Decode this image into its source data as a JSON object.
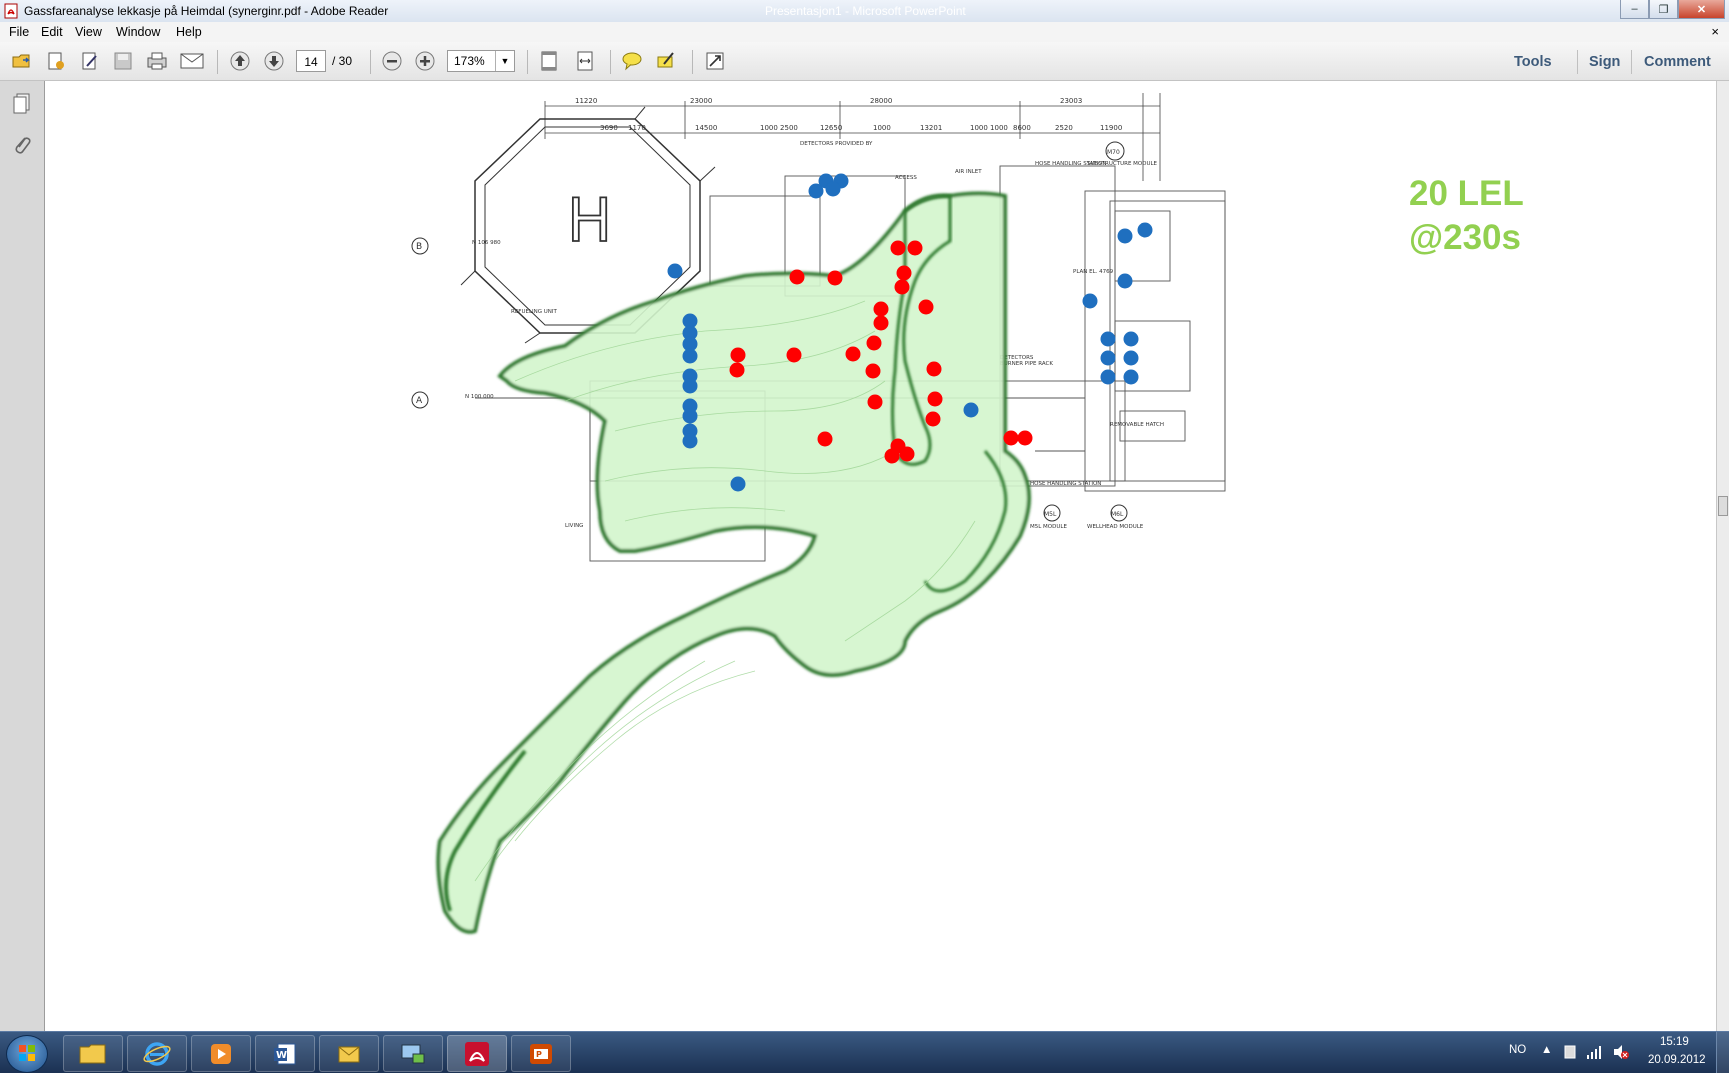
{
  "window": {
    "title": "Gassfareanalyse lekkasje på Heimdal (synerginr.pdf - Adobe Reader",
    "background_title": "Presentasjon1 - Microsoft PowerPoint",
    "minimize": "–",
    "maximize": "❐",
    "close": "✕"
  },
  "menu": {
    "items": [
      "File",
      "Edit",
      "View",
      "Window",
      "Help"
    ],
    "doc_close": "×"
  },
  "toolbar": {
    "page_current": "14",
    "page_total": "/ 30",
    "zoom": "173%",
    "right_links": [
      "Tools",
      "Sign",
      "Comment"
    ]
  },
  "document": {
    "overlay_line1": "20 LEL",
    "overlay_line2": "@230s",
    "colors": {
      "gas_fill": "#d3f5cc",
      "gas_edge": "#2f7a2f",
      "red_marker": "#ff0000",
      "blue_marker": "#1f6fbf",
      "overlay_text": "#92d050"
    },
    "drawing_texts": {
      "dims": [
        "11220",
        "23000",
        "28000",
        "23003",
        "3690",
        "1170",
        "14500",
        "1000 2500",
        "12650",
        "1000",
        "13201",
        "1000 1000",
        "8600",
        "2520",
        "11900"
      ],
      "labels": [
        "DETECTORS PROVIDED BY",
        "ACCESS",
        "AIR INLET",
        "HOSE HANDLING STATION",
        "SUBSTRUCTURE MODULE",
        "N 106 980",
        "REFUELING UNIT",
        "N 100 000",
        "DETECTORS",
        "BURNER PIPE RACK",
        "HOSE HANDLING STATION",
        "WELLHEAD MODULE",
        "LIVING",
        "REMOVABLE HATCH",
        "PLAN EL. 4769",
        "M5L MODULE"
      ],
      "grid_markers": [
        "B",
        "A",
        "M70",
        "M5L",
        "M6L"
      ],
      "heli_symbol": "H"
    }
  },
  "taskbar": {
    "apps": [
      "explorer",
      "internet-explorer",
      "media-player",
      "word",
      "outlook",
      "remote-desktop",
      "adobe-reader",
      "powerpoint"
    ],
    "lang": "NO",
    "time": "15:19",
    "date": "20.09.2012"
  }
}
